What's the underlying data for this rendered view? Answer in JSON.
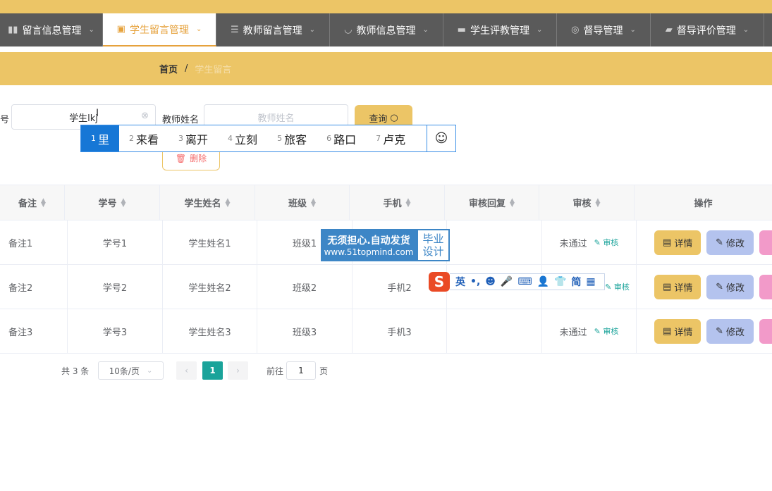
{
  "nav": [
    {
      "label": "留言信息管理",
      "icon": "bar-chart-icon",
      "glyph": "▮▮"
    },
    {
      "label": "学生留言管理",
      "icon": "clipboard-icon",
      "glyph": "▣",
      "active": true
    },
    {
      "label": "教师留言管理",
      "icon": "list-icon",
      "glyph": "☰"
    },
    {
      "label": "教师信息管理",
      "icon": "power-icon",
      "glyph": "◡"
    },
    {
      "label": "学生评教管理",
      "icon": "monitor-icon",
      "glyph": "▬"
    },
    {
      "label": "督导管理",
      "icon": "target-icon",
      "glyph": "◎"
    },
    {
      "label": "督导评价管理",
      "icon": "truck-icon",
      "glyph": "▰"
    }
  ],
  "breadcrumb": {
    "home": "首页",
    "sep": "/",
    "current": "学生留言"
  },
  "search": {
    "label_left": "号",
    "student_name_value": "学生lkj",
    "teacher_label": "教师姓名",
    "teacher_placeholder": "教师姓名",
    "query_label": "查询",
    "delete_label": "删除"
  },
  "ime": {
    "candidates": [
      "里",
      "来看",
      "离开",
      "立刻",
      "旅客",
      "路口",
      "卢克"
    ],
    "emoji": "☺",
    "toolbar": [
      "英",
      "•,",
      "☻",
      "🎤",
      "⌨",
      "👤",
      "👕",
      "简",
      "▦"
    ],
    "logo": "S"
  },
  "watermark": {
    "line1": "无须担心.自动发货",
    "line2": "www.51topmind.com",
    "right1": "毕业",
    "right2": "设计"
  },
  "table": {
    "columns": [
      "备注",
      "学号",
      "学生姓名",
      "班级",
      "手机",
      "审核回复",
      "审核",
      "操作"
    ],
    "rows": [
      {
        "note": "备注1",
        "id": "学号1",
        "name": "学生姓名1",
        "cls": "班级1",
        "phone": "",
        "reply": "",
        "status": "未通过",
        "audit": "审核"
      },
      {
        "note": "备注2",
        "id": "学号2",
        "name": "学生姓名2",
        "cls": "班级2",
        "phone": "手机2",
        "reply": "",
        "status": "",
        "audit": "审核"
      },
      {
        "note": "备注3",
        "id": "学号3",
        "name": "学生姓名3",
        "cls": "班级3",
        "phone": "手机3",
        "reply": "",
        "status": "未通过",
        "audit": "审核"
      }
    ],
    "detail_label": "详情",
    "edit_label": "修改"
  },
  "pager": {
    "total": "共 3 条",
    "page_size": "10条/页",
    "current_page": "1",
    "goto_prefix": "前往",
    "goto_value": "1",
    "goto_suffix": "页"
  }
}
